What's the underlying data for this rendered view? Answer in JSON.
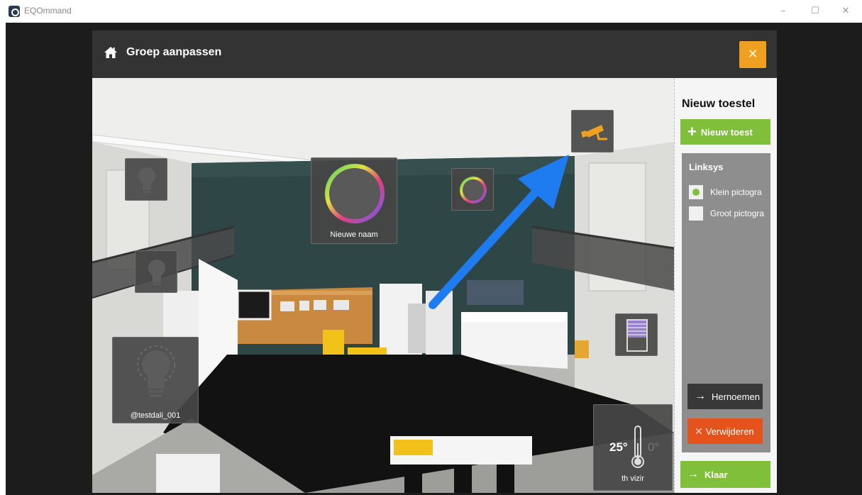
{
  "window": {
    "title": "EQOmmand",
    "minimize_glyph": "–",
    "maximize_glyph": "☐",
    "close_glyph": "✕"
  },
  "dialog": {
    "title": "Groep aanpassen",
    "close_glyph": "✕",
    "icon": "home-icon"
  },
  "devices": [
    {
      "id": "bulb-top",
      "icon": "lightbulb-icon",
      "label": ""
    },
    {
      "id": "bulb-mid",
      "icon": "lightbulb-icon",
      "label": ""
    },
    {
      "id": "bulb-large",
      "icon": "lightbulb-icon",
      "label": "@testdali_001"
    },
    {
      "id": "color-large",
      "icon": "color-wheel-icon",
      "label": "Nieuwe naam"
    },
    {
      "id": "color-small",
      "icon": "color-wheel-icon",
      "label": ""
    },
    {
      "id": "camera",
      "icon": "camera-icon",
      "label": ""
    },
    {
      "id": "shutter",
      "icon": "shutter-icon",
      "label": ""
    },
    {
      "id": "thermostat",
      "icon": "thermometer-icon",
      "label": "th vizir",
      "temp_left": "25°",
      "temp_right": "0°"
    }
  ],
  "panel": {
    "title": "Nieuw toestel",
    "new_device_button": "Nieuw toest",
    "group_title": "Linksys",
    "options": [
      {
        "label": "Klein pictogra",
        "selected": true
      },
      {
        "label": "Groot pictogra",
        "selected": false
      }
    ],
    "rename_button": "Hernoemen",
    "delete_button": "Verwijderen",
    "done_button": "Klaar"
  },
  "colors": {
    "accent_green": "#7fbf3a",
    "accent_orange": "#f0a020",
    "danger_red": "#e6521c",
    "arrow_blue": "#1e7cf0"
  }
}
